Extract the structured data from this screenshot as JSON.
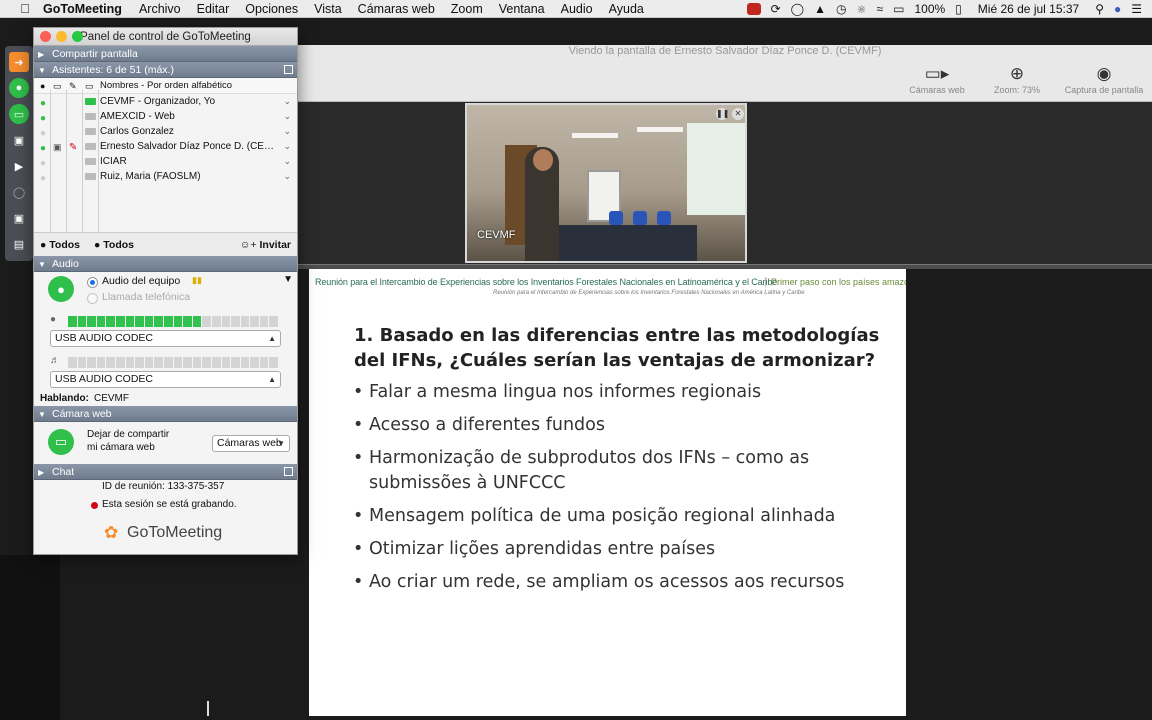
{
  "menubar": {
    "app": "GoToMeeting",
    "items": [
      "Archivo",
      "Editar",
      "Opciones",
      "Vista",
      "Cámaras web",
      "Zoom",
      "Ventana",
      "Audio",
      "Ayuda"
    ],
    "battery": "100%",
    "clock": "Mié 26 de jul  15:37"
  },
  "viewer": {
    "title": "Viendo la pantalla de Ernesto Salvador  Díaz Ponce D. (CEVMF)",
    "tools": [
      {
        "label": "Cámaras web",
        "icon": "webcam-icon"
      },
      {
        "label": "Zoom: 73%",
        "icon": "zoom-icon"
      },
      {
        "label": "Captura de pantalla",
        "icon": "camera-icon"
      }
    ],
    "webcam_label": "CEVMF"
  },
  "panel": {
    "title": "Panel de control de GoToMeeting",
    "share_section": "Compartir pantalla",
    "attendees_section": "Asistentes: 6 de 51 (máx.)",
    "sort_label": "Nombres - Por orden alfabético",
    "attendees": [
      {
        "name": "CEVMF - Organizador, Yo",
        "mic": true,
        "cam": true,
        "screen": false,
        "pen": false
      },
      {
        "name": "AMEXCID - Web",
        "mic": true,
        "cam": false,
        "screen": false,
        "pen": false
      },
      {
        "name": "Carlos Gonzalez",
        "mic": false,
        "cam": false,
        "screen": false,
        "pen": false
      },
      {
        "name": "Ernesto Salvador  Díaz Ponce D. (CEVMF) - P...",
        "mic": true,
        "cam": false,
        "screen": true,
        "pen": true
      },
      {
        "name": "ICIAR",
        "mic": false,
        "cam": false,
        "screen": false,
        "pen": false
      },
      {
        "name": "Ruiz, Maria (FAOSLM)",
        "mic": false,
        "cam": false,
        "screen": false,
        "pen": false
      }
    ],
    "mute_all_1": "Todos",
    "mute_all_2": "Todos",
    "invite": "Invitar",
    "audio_section": "Audio",
    "audio_option_1": "Audio del equipo",
    "audio_option_2": "Llamada telefónica",
    "mic_level": 0.62,
    "mic_device": "USB AUDIO  CODEC",
    "speaker_device": "USB AUDIO  CODEC",
    "speaking_label": "Hablando:",
    "speaking_value": "CEVMF",
    "webcam_section": "Cámara web",
    "webcam_text_1": "Dejar de compartir",
    "webcam_text_2": "mi cámara web",
    "webcam_select": "Cámaras web",
    "chat_section": "Chat",
    "meeting_id": "ID de reunión: 133-375-357",
    "recording": "Esta sesión se está grabando.",
    "logo": "GoToMeeting"
  },
  "slide": {
    "header_left": "Reunión para el Intercambio de Experiencias sobre los Inventarios Forestales  Nacionales en Latinoamérica y el Caribe",
    "header_right": "Primer paso con los países amazónicos",
    "header_sub": "Reunión para el Intercambio de Experiencias sobre los Inventarios Forestales Nacionales en América Latina y Caribe",
    "title": "1. Basado en las diferencias entre las metodologías del IFNs, ¿Cuáles serían las ventajas de armonizar?",
    "bullets": [
      "Falar a mesma lingua nos informes regionais",
      "Acesso a diferentes fundos",
      "Harmonização de subprodutos dos IFNs – como as submissões à UNFCCC",
      "Mensagem política de uma posição regional alinhada",
      "Otimizar lições aprendidas entre países",
      "Ao criar um rede, se ampliam os acessos aos recursos"
    ]
  },
  "colors": {
    "accent_green": "#2fbf4a",
    "section_blue": "#7a8798",
    "record_red": "#d0021b",
    "logo_orange": "#f68d2e"
  }
}
